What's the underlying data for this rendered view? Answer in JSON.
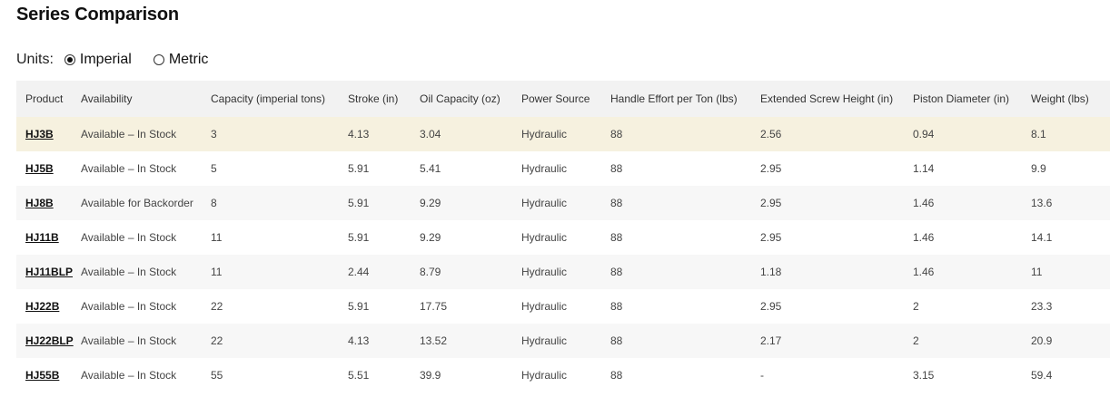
{
  "page": {
    "title": "Series Comparison"
  },
  "units": {
    "label": "Units:",
    "options": [
      {
        "label": "Imperial",
        "selected": true
      },
      {
        "label": "Metric",
        "selected": false
      }
    ]
  },
  "table": {
    "headers": [
      "Product",
      "Availability",
      "Capacity (imperial tons)",
      "Stroke (in)",
      "Oil Capacity (oz)",
      "Power Source",
      "Handle Effort per Ton (lbs)",
      "Extended Screw Height (in)",
      "Piston Diameter (in)",
      "Weight (lbs)"
    ],
    "rows": [
      [
        "HJ3B",
        "Available – In Stock",
        "3",
        "4.13",
        "3.04",
        "Hydraulic",
        "88",
        "2.56",
        "0.94",
        "8.1"
      ],
      [
        "HJ5B",
        "Available – In Stock",
        "5",
        "5.91",
        "5.41",
        "Hydraulic",
        "88",
        "2.95",
        "1.14",
        "9.9"
      ],
      [
        "HJ8B",
        "Available for Backorder",
        "8",
        "5.91",
        "9.29",
        "Hydraulic",
        "88",
        "2.95",
        "1.46",
        "13.6"
      ],
      [
        "HJ11B",
        "Available – In Stock",
        "11",
        "5.91",
        "9.29",
        "Hydraulic",
        "88",
        "2.95",
        "1.46",
        "14.1"
      ],
      [
        "HJ11BLP",
        "Available – In Stock",
        "11",
        "2.44",
        "8.79",
        "Hydraulic",
        "88",
        "1.18",
        "1.46",
        "11"
      ],
      [
        "HJ22B",
        "Available – In Stock",
        "22",
        "5.91",
        "17.75",
        "Hydraulic",
        "88",
        "2.95",
        "2",
        "23.3"
      ],
      [
        "HJ22BLP",
        "Available – In Stock",
        "22",
        "4.13",
        "13.52",
        "Hydraulic",
        "88",
        "2.17",
        "2",
        "20.9"
      ],
      [
        "HJ55B",
        "Available – In Stock",
        "55",
        "5.51",
        "39.9",
        "Hydraulic",
        "88",
        "-",
        "3.15",
        "59.4"
      ]
    ],
    "highlight_color": "#f6f1df"
  }
}
